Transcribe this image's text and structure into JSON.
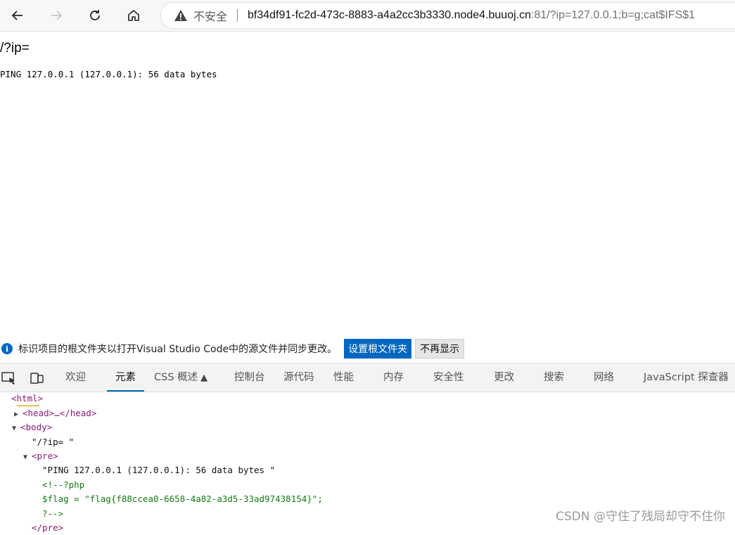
{
  "browser": {
    "back_icon": "arrow-left-icon",
    "forward_icon": "arrow-right-icon",
    "refresh_icon": "refresh-icon",
    "home_icon": "home-icon",
    "security_label": "不安全",
    "url_host": "bf34df91-fc2d-473c-8883-a4a2cc3b3330.node4.buuoj.cn",
    "url_rest": ":81/?ip=127.0.0.1;b=g;cat$IFS$1"
  },
  "page": {
    "heading": "/?ip=",
    "pre_text": "PING 127.0.0.1 (127.0.0.1): 56 data bytes"
  },
  "notification": {
    "message": "标识项目的根文件夹以打开Visual Studio Code中的源文件并同步更改。",
    "primary_button": "设置根文件夹",
    "secondary_button": "不再显示"
  },
  "devtools": {
    "tabs": [
      "欢迎",
      "元素",
      "CSS 概述",
      "控制台",
      "源代码",
      "性能",
      "内存",
      "安全性",
      "更改",
      "搜索",
      "网络",
      "JavaScript 探查器"
    ],
    "active_tab": "元素",
    "dom_lines": {
      "html_open": "<html>",
      "head": "<head>…</head>",
      "body_open": "<body>",
      "text_node": "\"/?ip= \"",
      "pre_open": "<pre>",
      "pre_text": "\"PING 127.0.0.1 (127.0.0.1): 56 data bytes \"",
      "comment_1": "<!--?php",
      "comment_2": "$flag = \"flag{f88ccea0-6658-4a82-a3d5-33ad97438154}\";",
      "comment_3": "?-->",
      "pre_close": "</pre>"
    }
  },
  "watermark": "CSDN @守住了残局却守不住你"
}
